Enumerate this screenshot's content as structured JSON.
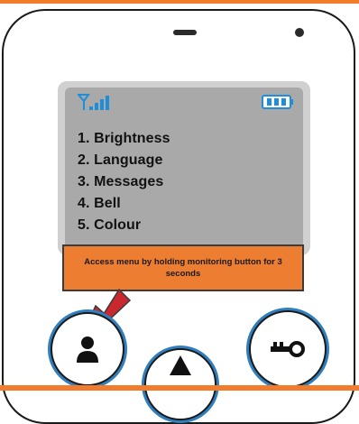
{
  "menu": {
    "items": [
      "1. Brightness",
      "2. Language",
      "3. Messages",
      "4. Bell",
      "5. Colour"
    ]
  },
  "callout": {
    "text": "Access menu by holding monitoring button for 3 seconds"
  },
  "icons": {
    "signal": "signal-strength-icon",
    "battery": "battery-icon",
    "left_button": "person-icon",
    "right_button": "key-icon",
    "center_button": "up-arrow-icon"
  },
  "colors": {
    "accent_orange": "#ed7d31",
    "button_ring_blue": "#2f7ebd",
    "status_icon_blue": "#1e8fd6",
    "screen_gray": "#a9a9a9",
    "arrow_red": "#c8282e"
  }
}
